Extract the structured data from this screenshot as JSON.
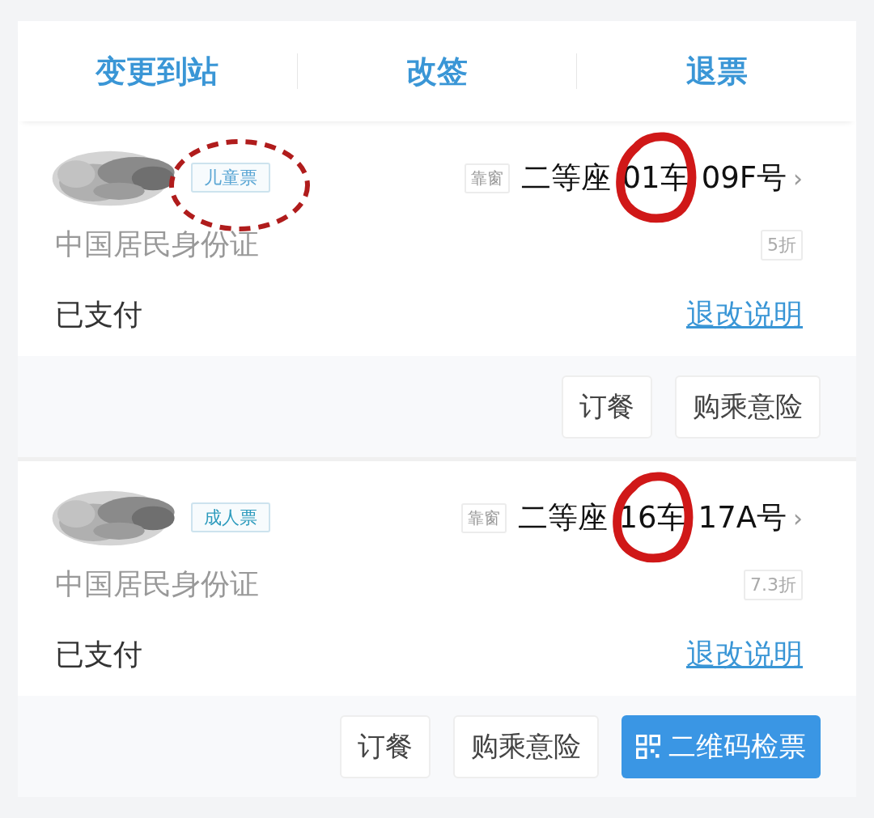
{
  "actions": [
    "变更到站",
    "改签",
    "退票"
  ],
  "passengers": [
    {
      "name": {
        "kind": "picture"
      },
      "ticket_type": "儿童票",
      "type_circled": true,
      "seat_position": "靠窗",
      "seat_class": "二等座",
      "car": "01车",
      "car_circled": true,
      "seat": "09F号",
      "arrow": "›",
      "id_type": "中国居民身份证",
      "discount": "5折",
      "status": "已支付",
      "rules_link": "退改说明",
      "buttons": [
        {
          "label": "订餐",
          "kind": "plain"
        },
        {
          "label": "购乘意险",
          "kind": "plain"
        }
      ]
    },
    {
      "name": {
        "kind": "picture"
      },
      "ticket_type": "成人票",
      "type_circled": false,
      "seat_position": "靠窗",
      "seat_class": "二等座",
      "car": "16车",
      "car_circled": true,
      "seat": "17A号",
      "arrow": "›",
      "id_type": "中国居民身份证",
      "discount": "7.3折",
      "status": "已支付",
      "rules_link": "退改说明",
      "buttons": [
        {
          "label": "订餐",
          "kind": "plain"
        },
        {
          "label": "购乘意险",
          "kind": "plain"
        },
        {
          "label": "二维码检票",
          "kind": "primary"
        }
      ]
    }
  ]
}
